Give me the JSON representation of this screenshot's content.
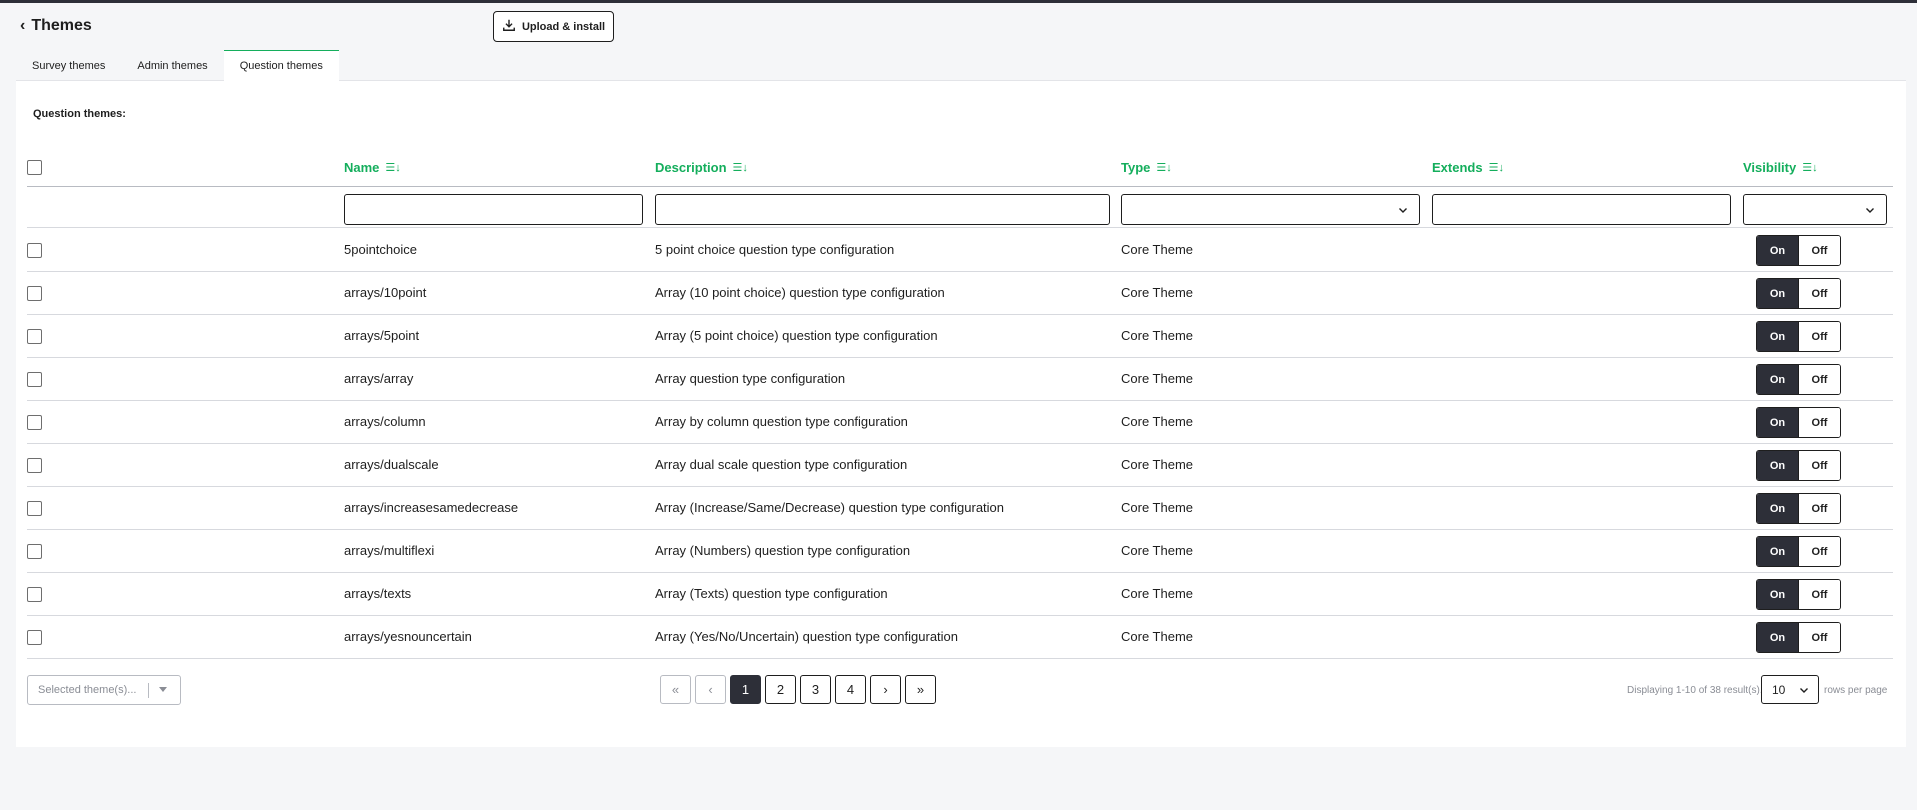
{
  "header": {
    "back_chevron": "‹",
    "title": "Themes",
    "upload_label": "Upload & install"
  },
  "tabs": [
    {
      "label": "Survey themes",
      "active": false
    },
    {
      "label": "Admin themes",
      "active": false
    },
    {
      "label": "Question themes",
      "active": true
    }
  ],
  "section_label": "Question themes:",
  "table": {
    "columns": {
      "name": "Name",
      "description": "Description",
      "type": "Type",
      "extends": "Extends",
      "visibility": "Visibility"
    },
    "filters": {
      "name": "",
      "description": "",
      "type": "",
      "extends": "",
      "visibility": ""
    },
    "toggle_on": "On",
    "toggle_off": "Off",
    "rows": [
      {
        "name": "5pointchoice",
        "description": "5 point choice question type configuration",
        "type": "Core Theme",
        "extends": "",
        "visible": "On"
      },
      {
        "name": "arrays/10point",
        "description": "Array (10 point choice) question type configuration",
        "type": "Core Theme",
        "extends": "",
        "visible": "On"
      },
      {
        "name": "arrays/5point",
        "description": "Array (5 point choice) question type configuration",
        "type": "Core Theme",
        "extends": "",
        "visible": "On"
      },
      {
        "name": "arrays/array",
        "description": "Array question type configuration",
        "type": "Core Theme",
        "extends": "",
        "visible": "On"
      },
      {
        "name": "arrays/column",
        "description": "Array by column question type configuration",
        "type": "Core Theme",
        "extends": "",
        "visible": "On"
      },
      {
        "name": "arrays/dualscale",
        "description": "Array dual scale question type configuration",
        "type": "Core Theme",
        "extends": "",
        "visible": "On"
      },
      {
        "name": "arrays/increasesamedecrease",
        "description": "Array (Increase/Same/Decrease) question type configuration",
        "type": "Core Theme",
        "extends": "",
        "visible": "On"
      },
      {
        "name": "arrays/multiflexi",
        "description": "Array (Numbers) question type configuration",
        "type": "Core Theme",
        "extends": "",
        "visible": "On"
      },
      {
        "name": "arrays/texts",
        "description": "Array (Texts) question type configuration",
        "type": "Core Theme",
        "extends": "",
        "visible": "On"
      },
      {
        "name": "arrays/yesnouncertain",
        "description": "Array (Yes/No/Uncertain) question type configuration",
        "type": "Core Theme",
        "extends": "",
        "visible": "On"
      }
    ]
  },
  "footer": {
    "bulk_placeholder": "Selected theme(s)...",
    "pagination": {
      "first": "«",
      "prev": "‹",
      "pages": [
        "1",
        "2",
        "3",
        "4"
      ],
      "current": "1",
      "next": "›",
      "last": "»"
    },
    "summary": "Displaying 1-10 of 38 result(s).",
    "per_page_value": "10",
    "per_page_label": "rows per page"
  },
  "colors": {
    "accent_green": "#14ae5c",
    "dark": "#2d2f38",
    "tab_marker": "#e1171c"
  }
}
